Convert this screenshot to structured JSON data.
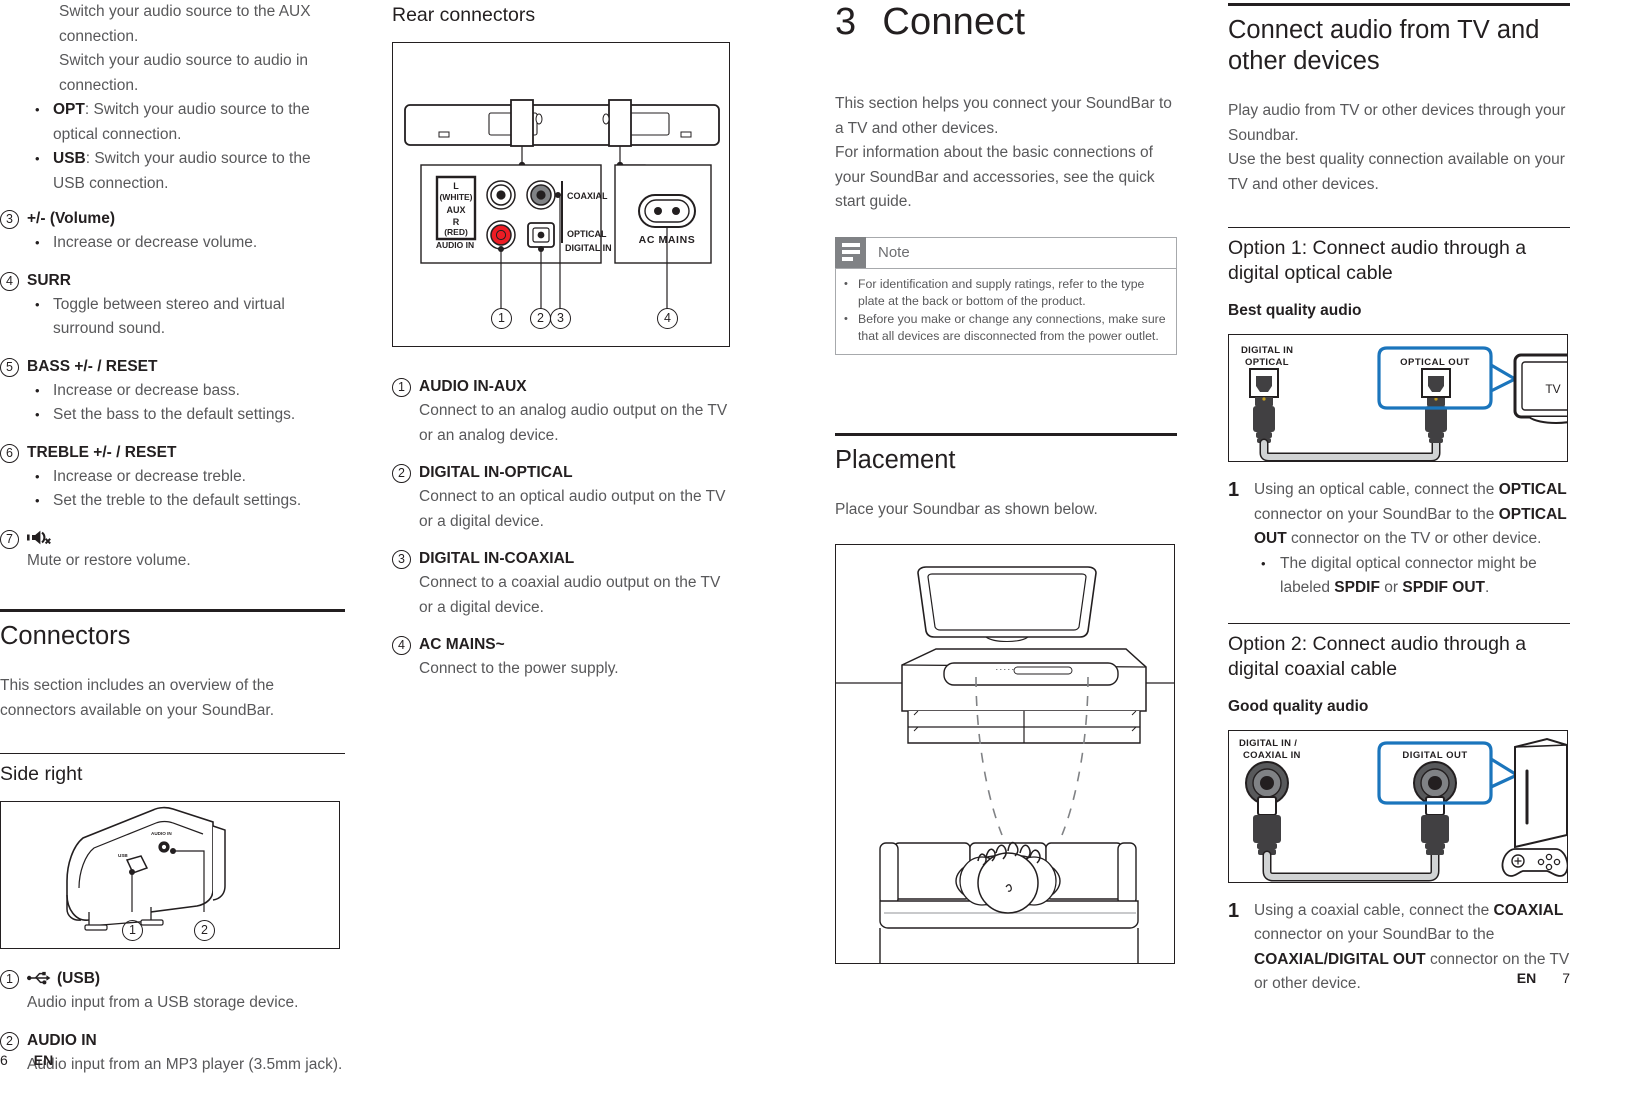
{
  "left_page": {
    "footer": {
      "page": "6",
      "lang": "EN"
    },
    "continued_items": [
      "Switch your audio source to the AUX connection.",
      "Switch your audio source to audio in connection."
    ],
    "continued_bullets": [
      {
        "bold": "OPT",
        "rest": ": Switch your audio source to the optical connection."
      },
      {
        "bold": "USB",
        "rest": ": Switch your audio source to the USB connection."
      }
    ],
    "controls": [
      {
        "num": "3",
        "label": "+/- (Volume)",
        "bullets": [
          "Increase or decrease volume."
        ]
      },
      {
        "num": "4",
        "label": "SURR",
        "bullets": [
          "Toggle between stereo and virtual surround sound."
        ]
      },
      {
        "num": "5",
        "label": "BASS +/- / RESET",
        "bullets": [
          "Increase or decrease bass.",
          "Set the bass to the default settings."
        ]
      },
      {
        "num": "6",
        "label": "TREBLE +/- / RESET",
        "bullets": [
          "Increase or decrease treble.",
          "Set the treble to the default settings."
        ]
      },
      {
        "num": "7",
        "label": "",
        "icon": "mute-speaker-icon",
        "desc": "Mute or restore volume."
      }
    ],
    "connectors_section": {
      "title": "Connectors",
      "intro": "This section includes an overview of the connectors available on your SoundBar.",
      "side_right_title": "Side right",
      "figure_callouts": [
        "1",
        "2"
      ],
      "figure_labels": {
        "audio_in": "AUDIO IN",
        "usb": "USB"
      },
      "items": [
        {
          "num": "1",
          "label": "(USB)",
          "icon": "usb-icon",
          "desc": "Audio input from a USB storage device."
        },
        {
          "num": "2",
          "label": "AUDIO IN",
          "desc": "Audio input from an MP3 player (3.5mm jack)."
        }
      ]
    },
    "rear_connectors": {
      "title": "Rear connectors",
      "figure_labels": {
        "l_white": "L",
        "l_white2": "(WHITE)",
        "aux": "AUX",
        "r_red": "R",
        "r_red2": "(RED)",
        "audio_in": "AUDIO IN",
        "coaxial": "COAXIAL",
        "optical": "OPTICAL",
        "digital_in": "DIGITAL IN",
        "ac_mains": "AC MAINS"
      },
      "figure_callouts": [
        "1",
        "2",
        "3",
        "4"
      ],
      "items": [
        {
          "num": "1",
          "label": "AUDIO IN-AUX",
          "desc": "Connect to an analog audio output on the TV or an analog device."
        },
        {
          "num": "2",
          "label": "DIGITAL IN-OPTICAL",
          "desc": "Connect to an optical audio output on the TV or a digital device."
        },
        {
          "num": "3",
          "label": "DIGITAL IN-COAXIAL",
          "desc": "Connect to a coaxial audio output on the TV or a digital device."
        },
        {
          "num": "4",
          "label": "AC MAINS~",
          "desc": "Connect to the power supply."
        }
      ]
    }
  },
  "right_page": {
    "footer": {
      "page": "7",
      "lang": "EN"
    },
    "chapter": {
      "number": "3",
      "title": "Connect"
    },
    "chapter_intro": [
      "This section helps you connect your SoundBar to a TV and other devices.",
      "For information about the basic connections of your SoundBar and accessories, see the quick start guide."
    ],
    "note": {
      "title": "Note",
      "items": [
        "For identification and supply ratings, refer to the type plate at the back or bottom of the product.",
        "Before you make or change any connections, make sure that all devices are disconnected from the power outlet."
      ]
    },
    "placement": {
      "title": "Placement",
      "intro": "Place your Soundbar as shown below."
    },
    "connect_audio": {
      "title": "Connect audio from TV and other devices",
      "paragraphs": [
        "Play audio from TV or other devices through your Soundbar.",
        "Use the best quality connection available on your TV and other devices."
      ],
      "options": [
        {
          "title": "Option 1: Connect audio through a digital optical cable",
          "quality": "Best quality audio",
          "figure_labels": {
            "source_line1": "DIGITAL IN",
            "source_line2": "OPTICAL",
            "target": "OPTICAL OUT",
            "device": "TV"
          },
          "step_num": "1",
          "step_parts": [
            {
              "t": "Using an optical cable, connect the ",
              "b": false
            },
            {
              "t": "OPTICAL",
              "b": true
            },
            {
              "t": " connector on your SoundBar to the ",
              "b": false
            },
            {
              "t": "OPTICAL OUT",
              "b": true
            },
            {
              "t": " connector on the TV or other device.",
              "b": false
            }
          ],
          "substep_parts": [
            {
              "t": "The digital optical connector might be labeled ",
              "b": false
            },
            {
              "t": "SPDIF",
              "b": true
            },
            {
              "t": " or ",
              "b": false
            },
            {
              "t": "SPDIF OUT",
              "b": true
            },
            {
              "t": ".",
              "b": false
            }
          ]
        },
        {
          "title": "Option 2: Connect audio through a digital coaxial cable",
          "quality": "Good quality audio",
          "figure_labels": {
            "source_line1": "DIGITAL IN /",
            "source_line2": "COAXIAL IN",
            "target": "DIGITAL OUT",
            "device": "game-console-icon"
          },
          "step_num": "1",
          "step_parts": [
            {
              "t": "Using a coaxial cable, connect the ",
              "b": false
            },
            {
              "t": "COAXIAL",
              "b": true
            },
            {
              "t": " connector on your SoundBar to the ",
              "b": false
            },
            {
              "t": "COAXIAL/DIGITAL OUT",
              "b": true
            },
            {
              "t": " connector on the TV or other device.",
              "b": false
            }
          ]
        }
      ]
    }
  },
  "colors": {
    "text_dark": "#231f20",
    "text_body": "#58585a",
    "note_icon_bg": "#808285",
    "note_border": "#a7a9ac",
    "callout_blue": "#1b75bc",
    "red_rca": "#ed1c24",
    "cable_gray": "#d1d3d4"
  }
}
